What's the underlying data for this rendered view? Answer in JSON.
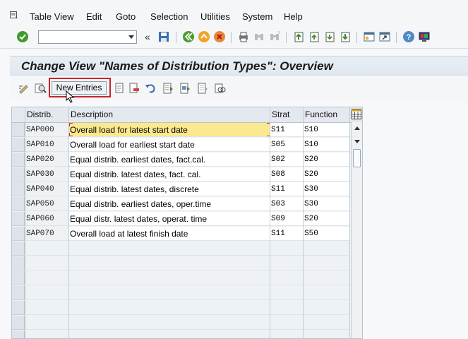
{
  "menu": {
    "items": [
      "Table View",
      "Edit",
      "Goto",
      "Selection",
      "Utilities",
      "System",
      "Help"
    ]
  },
  "command_field": {
    "value": ""
  },
  "screen_title": "Change View \"Names of Distribution Types\": Overview",
  "app_toolbar": {
    "new_entries_label": "New Entries"
  },
  "table": {
    "headers": {
      "distrib": "Distrib.",
      "description": "Description",
      "strat": "Strat",
      "function": "Function"
    },
    "rows": [
      {
        "distrib": "SAP000",
        "description": "Overall load for latest start date",
        "strat": "S11",
        "function": "S10"
      },
      {
        "distrib": "SAP010",
        "description": "Overall load for earliest start date",
        "strat": "S05",
        "function": "S10"
      },
      {
        "distrib": "SAP020",
        "description": "Equal distrib. earliest dates, fact.cal.",
        "strat": "S02",
        "function": "S20"
      },
      {
        "distrib": "SAP030",
        "description": "Equal distrib. latest dates, fact. cal.",
        "strat": "S08",
        "function": "S20"
      },
      {
        "distrib": "SAP040",
        "description": "Equal distrib. latest dates, discrete",
        "strat": "S11",
        "function": "S30"
      },
      {
        "distrib": "SAP050",
        "description": "Equal distrib. earliest dates, oper.time",
        "strat": "S03",
        "function": "S30"
      },
      {
        "distrib": "SAP060",
        "description": "Equal distr. latest dates, operat. time",
        "strat": "S09",
        "function": "S20"
      },
      {
        "distrib": "SAP070",
        "description": "Overall load at latest finish date",
        "strat": "S11",
        "function": "S50"
      }
    ],
    "empty_rows": 7
  },
  "colors": {
    "focus_highlight": "#fbe98f",
    "annotation_box": "#c8232c"
  }
}
